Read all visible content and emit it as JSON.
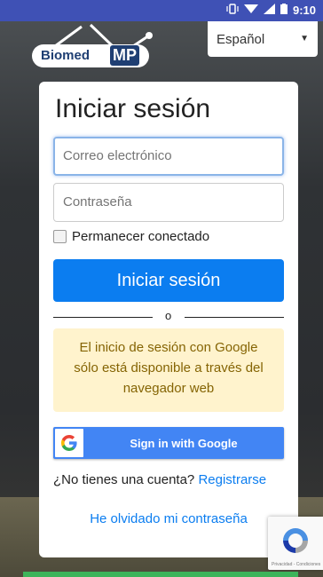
{
  "status_bar": {
    "time": "9:10"
  },
  "logo": {
    "part1": "Biomed",
    "part2": "MP"
  },
  "language": {
    "selected": "Español"
  },
  "login": {
    "title": "Iniciar sesión",
    "email_placeholder": "Correo electrónico",
    "password_placeholder": "Contraseña",
    "remember_label": "Permanecer conectado",
    "submit_label": "Iniciar sesión",
    "divider_text": "o",
    "google_notice": "El inicio de sesión con Google sólo está disponible a través del navegador web",
    "google_button_label": "Sign in with Google",
    "no_account_text": "¿No tienes una cuenta?",
    "register_link": "Registrarse",
    "forgot_password": "He olvidado mi contraseña"
  },
  "recaptcha": {
    "text": "Privacidad - Condiciones"
  },
  "colors": {
    "status_bar": "#3f51b5",
    "primary": "#0b7df0",
    "google_blue": "#4285f4",
    "notice_bg": "#fff3cd",
    "notice_text": "#856404"
  }
}
